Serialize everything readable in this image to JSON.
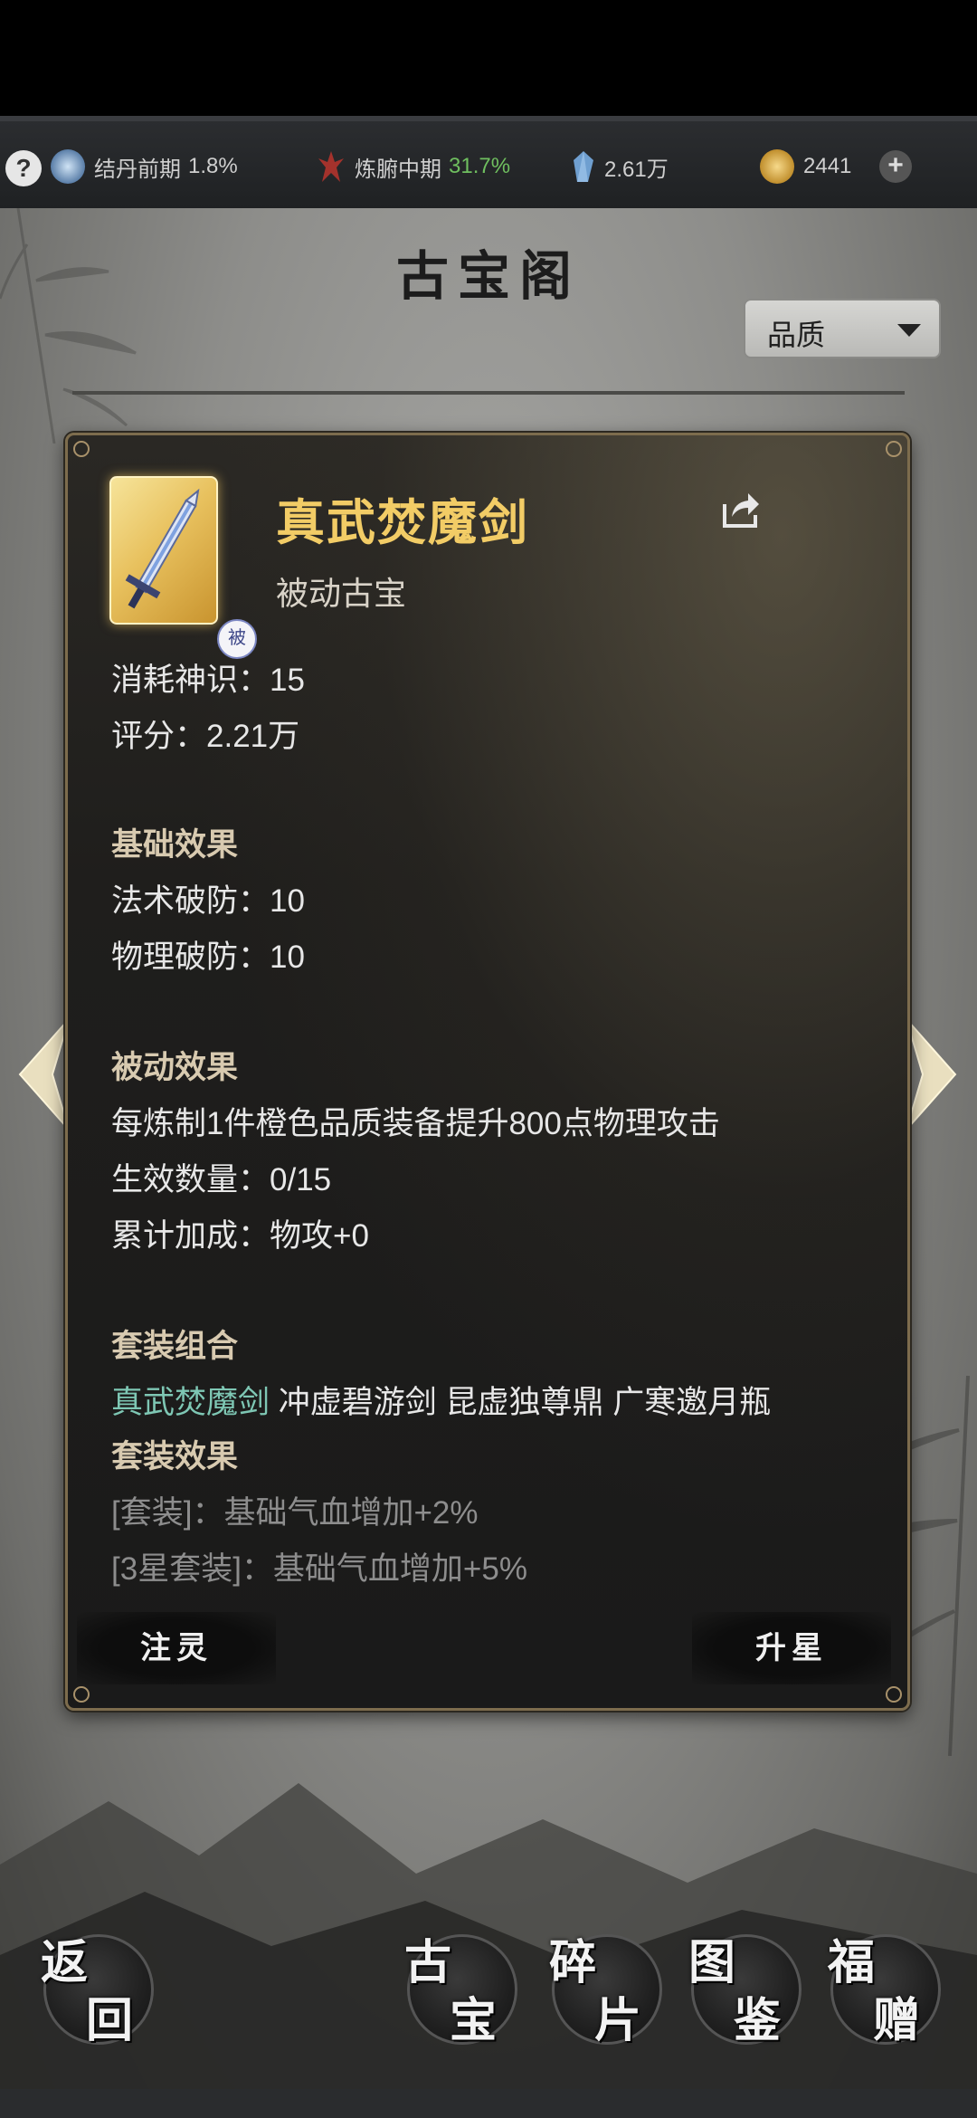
{
  "status_bar": {
    "realm": "结丹前期",
    "realm_pct": "1.8%",
    "body_realm": "炼腑中期",
    "body_pct": "31.7%",
    "spirit_stones": "2.61万",
    "currency": "2441",
    "colors": {
      "body_pct": "#6fbf5f"
    }
  },
  "page": {
    "title": "古宝阁"
  },
  "filter": {
    "selected": "品质"
  },
  "item": {
    "name": "真武焚魔剑",
    "type": "被动古宝",
    "badge": "被",
    "cost": "消耗神识：15",
    "score": "评分：2.21万",
    "base_heading": "基础效果",
    "base_effects": [
      "法术破防：10",
      "物理破防：10"
    ],
    "passive_heading": "被动效果",
    "passive_desc": "每炼制1件橙色品质装备提升800点物理攻击",
    "active_count": "生效数量：0/15",
    "total_bonus": "累计加成：物攻+0",
    "set_heading": "套装组合",
    "set_members": [
      "真武焚魔剑",
      "冲虚碧游剑",
      "昆虚独尊鼎",
      "广寒邀月瓶"
    ],
    "set_effect_heading": "套装效果",
    "set_effects": [
      "[套装]：基础气血增加+2%",
      "[3星套装]：基础气血增加+5%"
    ],
    "colors": {
      "name": "#f2cc66",
      "owned_set_member": "#7ec7b4"
    }
  },
  "card_buttons": {
    "infuse": "注灵",
    "star_up": "升星"
  },
  "bottom_nav": {
    "back": [
      "返",
      "回"
    ],
    "treasure": [
      "古",
      "宝"
    ],
    "fragments": [
      "碎",
      "片"
    ],
    "codex": [
      "图",
      "鉴"
    ],
    "gift": [
      "福",
      "赠"
    ]
  },
  "icons": [
    "help-icon",
    "realm-icon",
    "body-realm-icon",
    "spirit-stone-icon",
    "currency-icon",
    "plus-icon",
    "share-icon",
    "sword-icon",
    "arrow-left-icon",
    "arrow-right-icon"
  ]
}
